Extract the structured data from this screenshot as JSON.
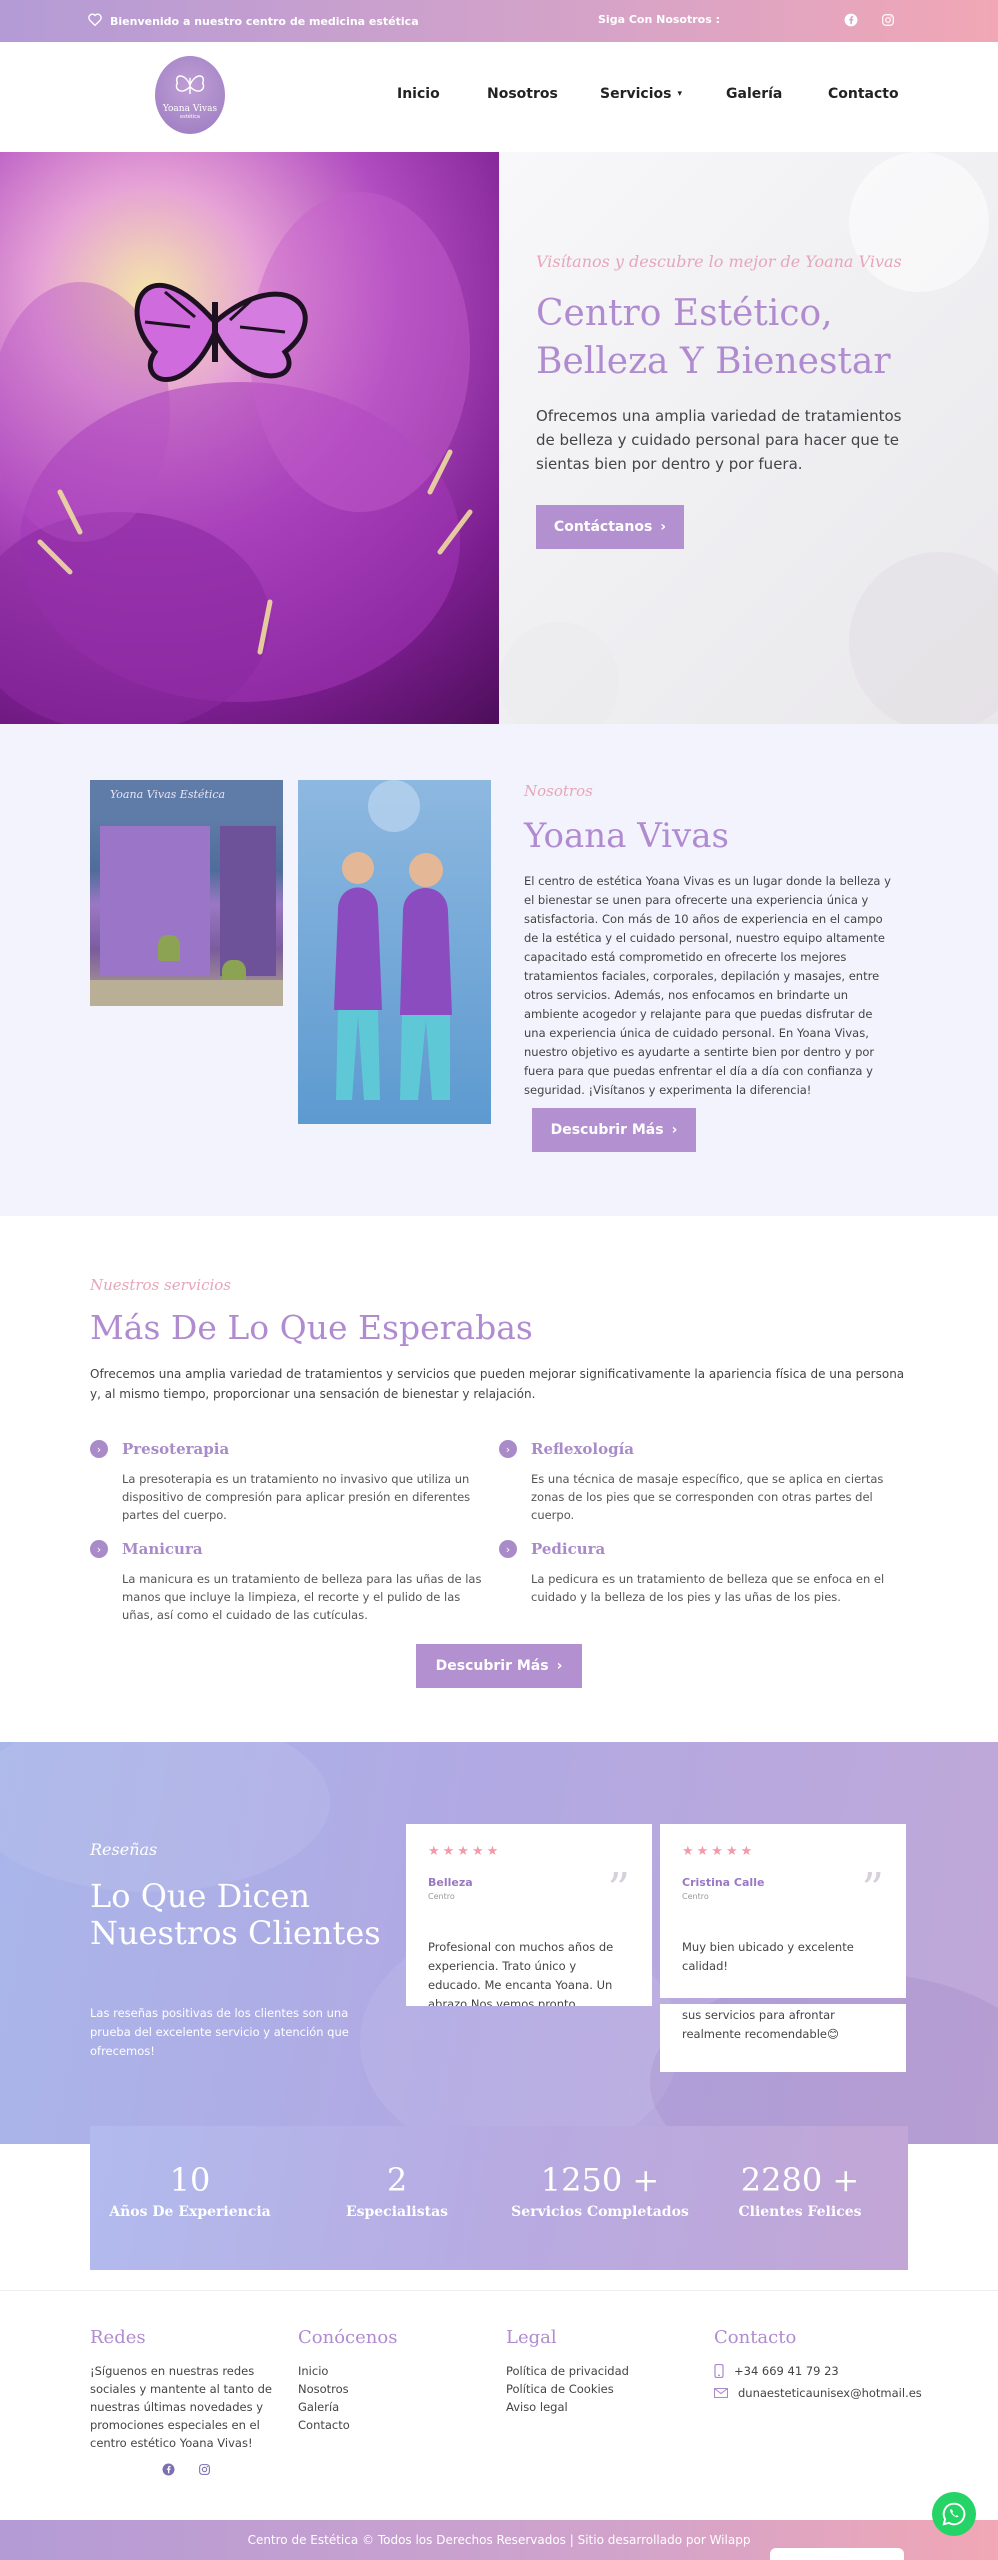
{
  "colors": {
    "brand_purple": "#b18bd0",
    "accent_pink": "#e7a6b8",
    "star_pink": "#f19aa8",
    "whatsapp_green": "#25d366"
  },
  "topbar": {
    "welcome": "Bienvenido a nuestro centro de medicina estética",
    "follow": "Siga Con Nosotros :",
    "icons": [
      "heart-icon",
      "facebook-icon",
      "instagram-icon"
    ]
  },
  "header": {
    "logo_title": "Yoana Vivas",
    "logo_sub": "estética",
    "nav": {
      "inicio": "Inicio",
      "nosotros": "Nosotros",
      "servicios": "Servicios",
      "galeria": "Galería",
      "contacto": "Contacto"
    }
  },
  "hero": {
    "kicker": "Visítanos y descubre lo mejor de Yoana Vivas",
    "title": "Centro Estético, Belleza Y Bienestar",
    "text": "Ofrecemos una amplia variedad de tratamientos de belleza y cuidado personal para hacer que te sientas bien por dentro y por fuera.",
    "button": "Contáctanos"
  },
  "about": {
    "photo_sign": "Yoana Vivas  Estética",
    "kicker": "Nosotros",
    "title": "Yoana Vivas",
    "text": "El centro de estética Yoana Vivas es un lugar donde la belleza y el bienestar se unen para ofrecerte una experiencia única y satisfactoria. Con más de 10 años de experiencia en el campo de la estética y el cuidado personal, nuestro equipo altamente capacitado está comprometido en ofrecerte los mejores tratamientos faciales, corporales, depilación y masajes, entre otros servicios. Además, nos enfocamos en brindarte un ambiente acogedor y relajante para que puedas disfrutar de una experiencia única de cuidado personal. En Yoana Vivas, nuestro objetivo es ayudarte a sentirte bien por dentro y por fuera para que puedas enfrentar el día a día con confianza y seguridad. ¡Visítanos y experimenta la diferencia!",
    "button": "Descubrir Más"
  },
  "services": {
    "kicker": "Nuestros servicios",
    "title": "Más De Lo Que Esperabas",
    "intro": "Ofrecemos una amplia variedad de tratamientos y servicios que pueden mejorar significativamente la apariencia física de una persona y, al mismo tiempo, proporcionar una sensación de bienestar y relajación.",
    "items": [
      {
        "name": "Presoterapia",
        "desc": "La presoterapia es un tratamiento no invasivo que utiliza un dispositivo de compresión para aplicar presión en diferentes partes del cuerpo."
      },
      {
        "name": "Reflexología",
        "desc": "Es una técnica de masaje específico, que se aplica en ciertas zonas de los pies que se corresponden con otras partes del cuerpo."
      },
      {
        "name": "Manicura",
        "desc": "La manicura es un tratamiento de belleza para las uñas de las manos que incluye la limpieza, el recorte y el pulido de las uñas, así como el cuidado de las cutículas."
      },
      {
        "name": "Pedicura",
        "desc": "La pedicura es un tratamiento de belleza que se enfoca en el cuidado y la belleza de los pies y las uñas de los pies."
      }
    ],
    "button": "Descubrir Más"
  },
  "reviews": {
    "kicker": "Reseñas",
    "title": "Lo Que Dicen Nuestros Clientes",
    "text": "Las reseñas positivas de los clientes son una prueba del excelente servicio y atención que ofrecemos!",
    "cards": [
      {
        "stars": "★★★★★",
        "rating": 5,
        "name": "Belleza",
        "role": "Centro",
        "quote": "Profesional con muchos años de experiencia. Trato único y educado. Me encanta Yoana. Un abrazo Nos vemos pronto"
      },
      {
        "stars": "★★★★★",
        "rating": 5,
        "name": "Cristina Calle",
        "role": "Centro",
        "quote": "Muy bien ubicado y excelente calidad!"
      }
    ],
    "overflow_text": "sus servicios para afrontar realmente recomendable😊"
  },
  "stats": [
    {
      "num": "10",
      "label": "Años De Experiencia"
    },
    {
      "num": "2",
      "label": "Especialistas"
    },
    {
      "num": "1250 +",
      "label": "Servicios Completados"
    },
    {
      "num": "2280 +",
      "label": "Clientes Felices"
    }
  ],
  "footer": {
    "redes": {
      "title": "Redes",
      "text": "¡Síguenos en nuestras redes sociales y mantente al tanto de nuestras últimas novedades y promociones especiales en el centro estético Yoana Vivas!"
    },
    "conocenos": {
      "title": "Conócenos",
      "links": [
        "Inicio",
        "Nosotros",
        "Galería",
        "Contacto"
      ]
    },
    "legal": {
      "title": "Legal",
      "links": [
        "Política de privacidad",
        "Política de Cookies",
        "Aviso legal"
      ]
    },
    "contacto": {
      "title": "Contacto",
      "phone": "+34 669 41 79 23",
      "email": "dunaesteticaunisex@hotmail.es"
    },
    "copyright": "Centro de Estética © Todos los Derechos Reservados | Sitio desarrollado por Wilapp"
  }
}
